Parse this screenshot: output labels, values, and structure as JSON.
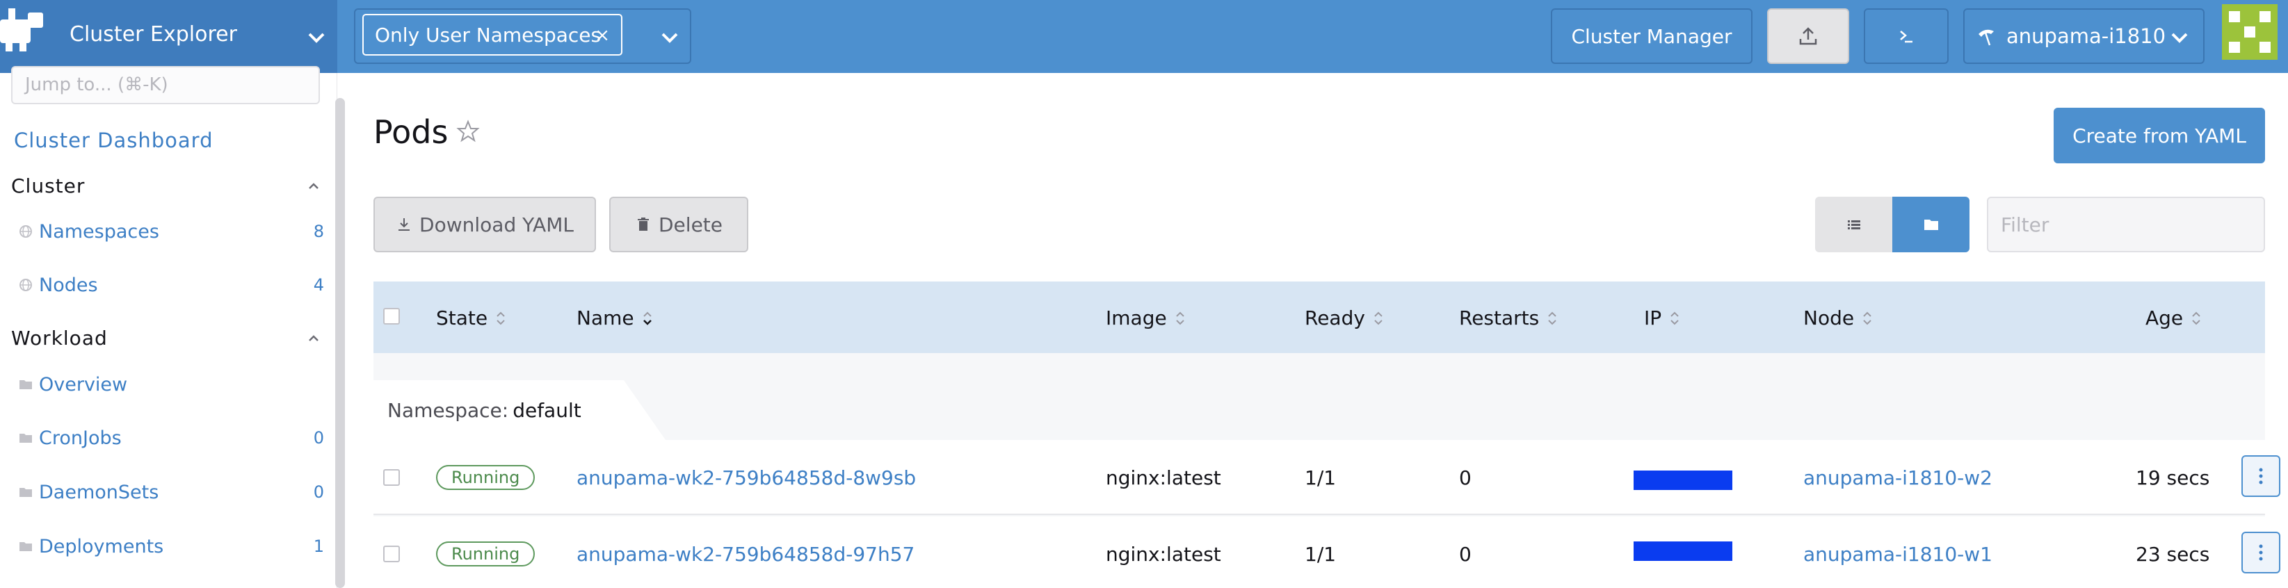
{
  "header": {
    "app_title": "Cluster Explorer",
    "namespace_filter": "Only User Namespaces",
    "namespace_filter_remove": "×",
    "cluster_manager_label": "Cluster Manager",
    "cluster_name": "anupama-i1810",
    "accent_color": "#4d90cf"
  },
  "sidebar": {
    "jump_placeholder": "Jump to... (⌘-K)",
    "dashboard_link": "Cluster Dashboard",
    "groups": [
      {
        "title": "Cluster",
        "items": [
          {
            "label": "Namespaces",
            "count": "8",
            "icon": "globe-icon"
          },
          {
            "label": "Nodes",
            "count": "4",
            "icon": "globe-icon"
          }
        ]
      },
      {
        "title": "Workload",
        "items": [
          {
            "label": "Overview",
            "count": "",
            "icon": "folder-icon"
          },
          {
            "label": "CronJobs",
            "count": "0",
            "icon": "folder-icon"
          },
          {
            "label": "DaemonSets",
            "count": "0",
            "icon": "folder-icon"
          },
          {
            "label": "Deployments",
            "count": "1",
            "icon": "folder-icon"
          }
        ]
      }
    ]
  },
  "main": {
    "title": "Pods",
    "create_button": "Create from YAML",
    "download_button": "Download YAML",
    "delete_button": "Delete",
    "filter_placeholder": "Filter",
    "table": {
      "columns": [
        "State",
        "Name",
        "Image",
        "Ready",
        "Restarts",
        "IP",
        "Node",
        "Age"
      ],
      "namespace_label": "Namespace:",
      "namespace_value": "default",
      "rows": [
        {
          "state": "Running",
          "name": "anupama-wk2-759b64858d-8w9sb",
          "image": "nginx:latest",
          "ready": "1/1",
          "restarts": "0",
          "node": "anupama-i1810-w2",
          "age": "19 secs"
        },
        {
          "state": "Running",
          "name": "anupama-wk2-759b64858d-97h57",
          "image": "nginx:latest",
          "ready": "1/1",
          "restarts": "0",
          "node": "anupama-i1810-w1",
          "age": "23 secs"
        }
      ]
    }
  }
}
